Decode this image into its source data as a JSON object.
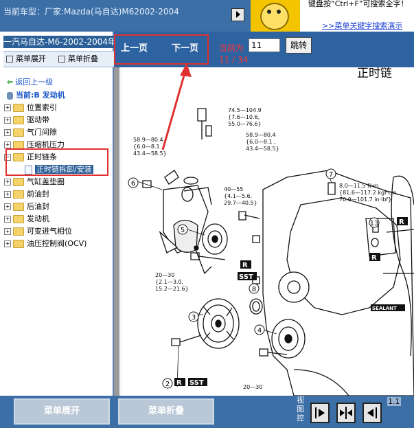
{
  "header": {
    "vehicle_label": "当前车型：厂家:Mazda(马自达)M62002-2004",
    "search_tip": "键盘按“Ctrl+F”可搜索全字！",
    "search_link": ">>菜单关键字搜索演示"
  },
  "sidebar": {
    "title": "一汽马自达-M6-2002-2004年",
    "expand_menu": "菜单展开",
    "collapse_menu": "菜单折叠",
    "back_link": "返回上一级",
    "current": "当前:B 发动机",
    "items": [
      {
        "label": "位置索引"
      },
      {
        "label": "驱动带"
      },
      {
        "label": "气门间隙"
      },
      {
        "label": "压缩机压力"
      },
      {
        "label": "正时链条"
      },
      {
        "label": "正时链拆卸/安装"
      },
      {
        "label": "气缸盖垫圈"
      },
      {
        "label": "前油封"
      },
      {
        "label": "后油封"
      },
      {
        "label": "发动机"
      },
      {
        "label": "可变进气相位"
      },
      {
        "label": "油压控制阀(OCV)"
      }
    ]
  },
  "toolbar": {
    "prev_page": "上一页",
    "next_page": "下一页",
    "current_label": "当前为",
    "page_input_value": "11",
    "go_button": "跳转",
    "page_count": "11 / 34"
  },
  "document": {
    "title": "正时链",
    "labels": {
      "torque1": "74.5—104.9",
      "torque1b": "{7.6—10.6,",
      "torque1c": "55.0—76.6}",
      "torque2": "58.9—80.4",
      "torque2b": "{6.0—8.1 ,",
      "torque2c": "43.4—58.5}",
      "torque3": "58.9—80.4",
      "torque3b": "{6.0—8.1 ,",
      "torque3c": "43.4—58.5}",
      "torque4": "40—55",
      "torque4b": "{4.1—5.6,",
      "torque4c": "29.7—40.5}",
      "torque5": "8.0—11.5 N·m",
      "torque5b": "{81.6—117.2 kgf·cm,",
      "torque5c": "70.9—101.7 in·lbf}",
      "torque6": "20—30",
      "torque6b": "{2.1—3.0,",
      "torque6c": "15.2—21.6}",
      "torque7": "20—30",
      "callouts": [
        "6",
        "7",
        "5",
        "13",
        "8",
        "3",
        "4",
        "2"
      ],
      "badge_r": "R",
      "badge_sst": "SST",
      "sealant": "SEALANT"
    }
  },
  "bottom": {
    "expand_menu": "菜单展开",
    "collapse_menu": "菜单折叠",
    "view_label": "视图控",
    "zoom": "1.1"
  },
  "colors": {
    "highlight": "#e03030",
    "bar_blue": "#2d63a0",
    "link_blue": "#1b57c8"
  }
}
